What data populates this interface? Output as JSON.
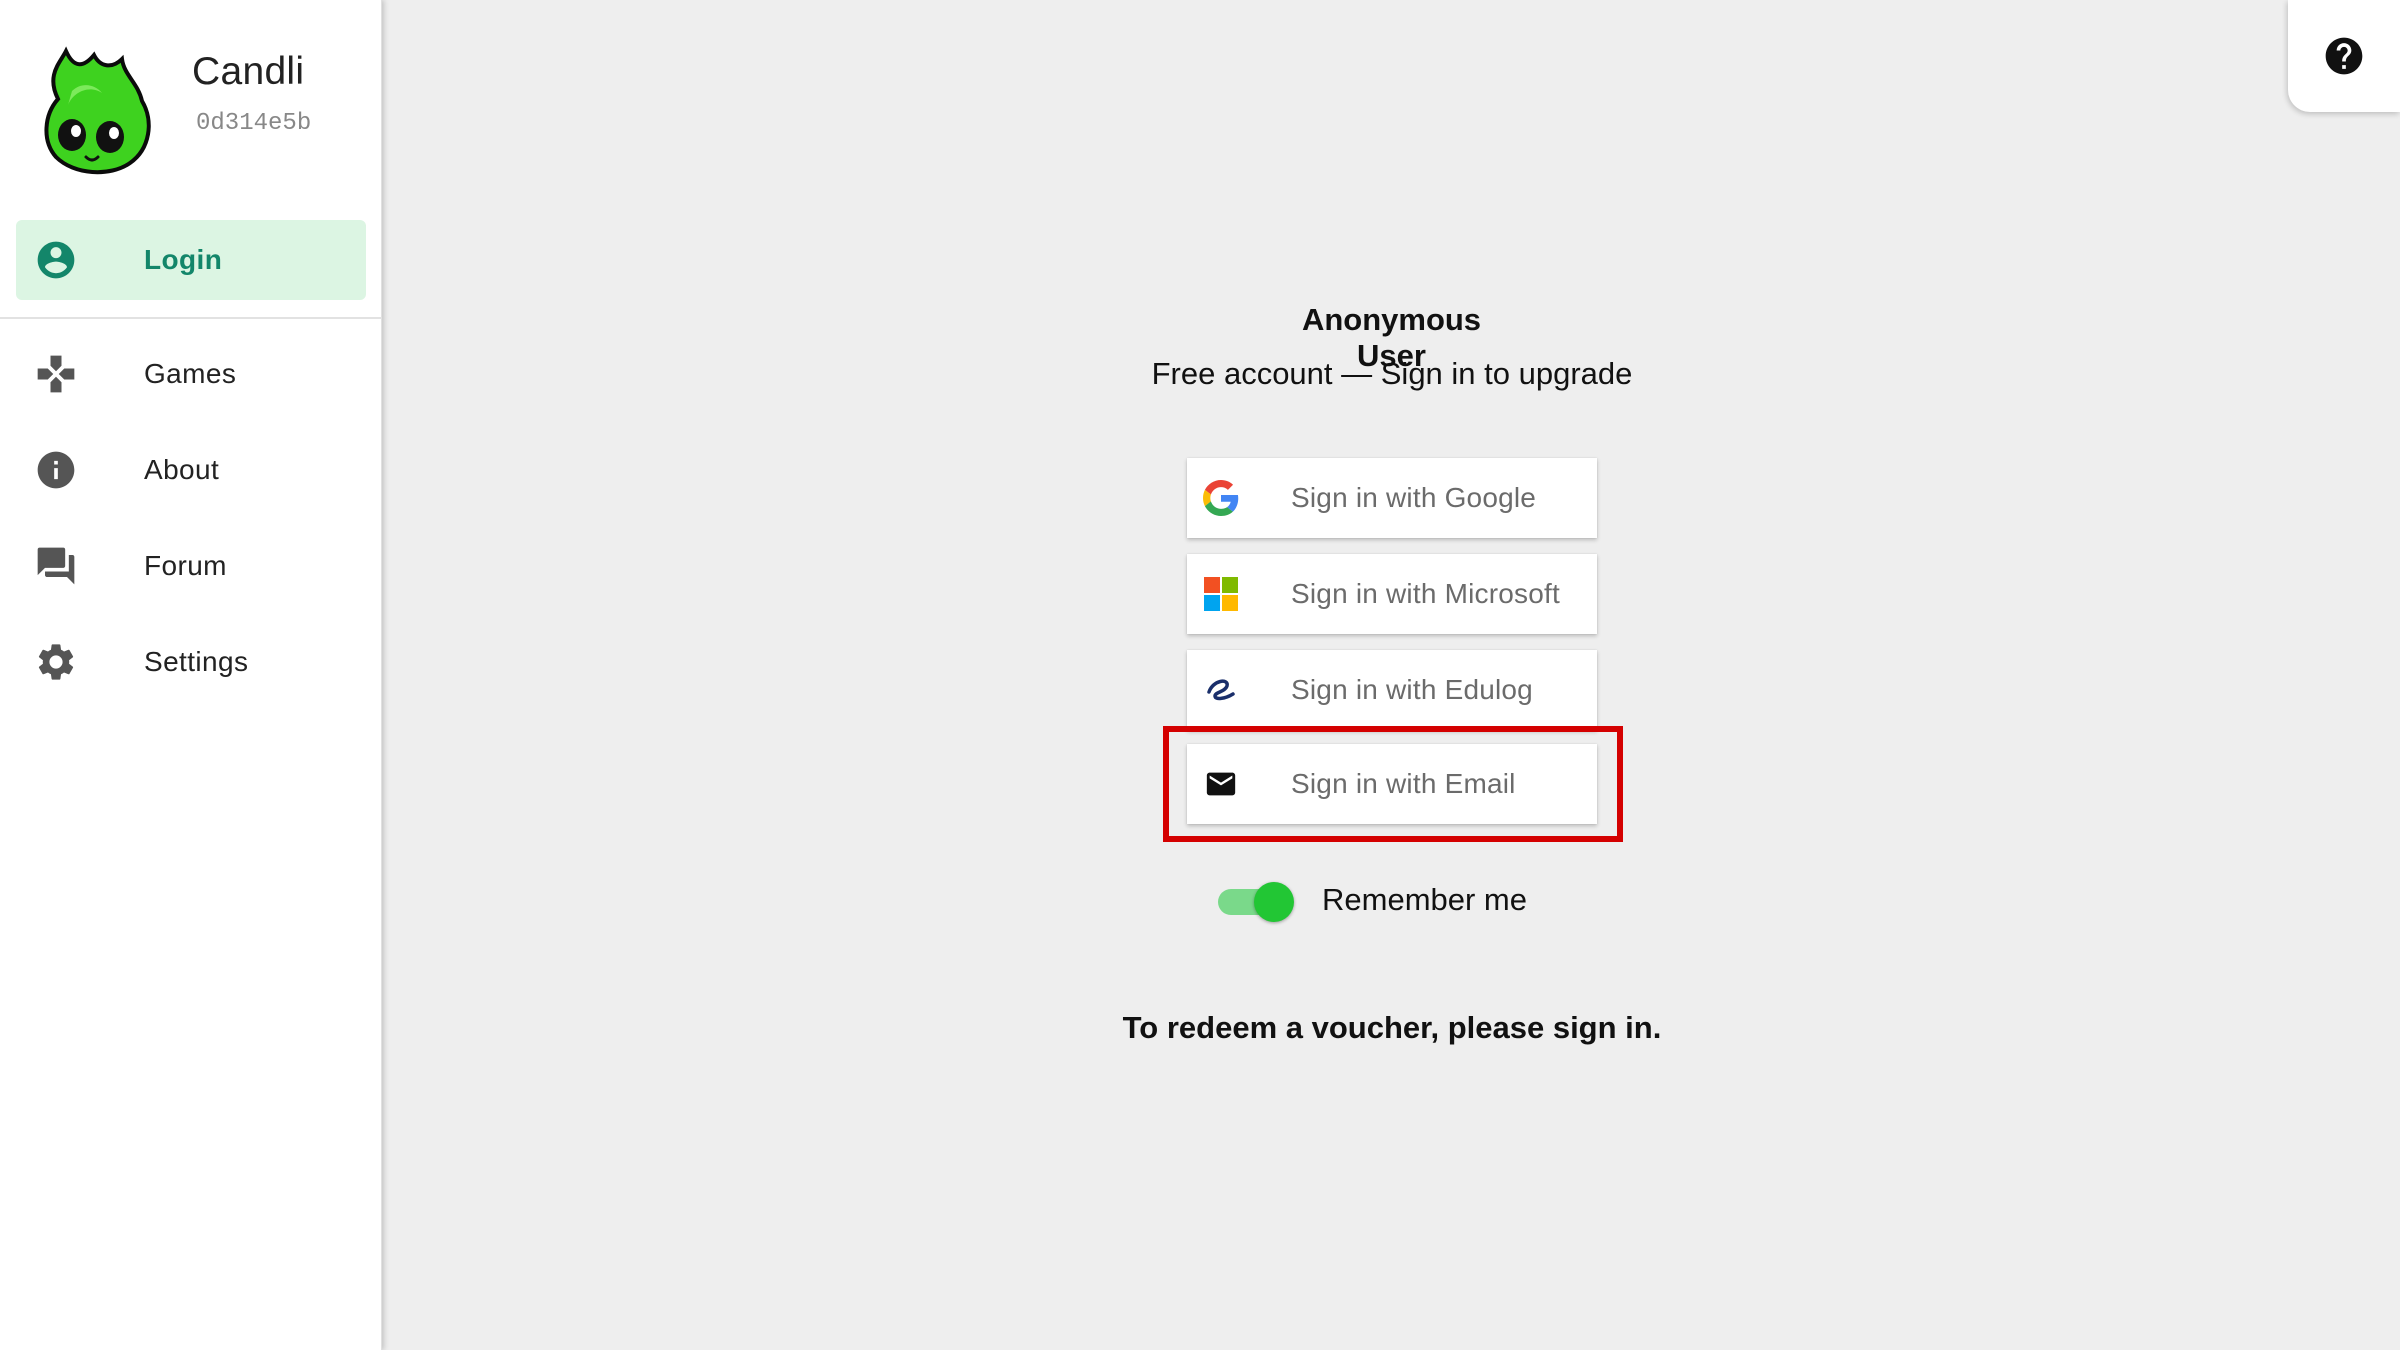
{
  "brand": {
    "name": "Candli",
    "id": "0d314e5b"
  },
  "sidebar": {
    "items": [
      {
        "label": "Login",
        "icon": "account-circle-icon",
        "active": true
      },
      {
        "label": "Games",
        "icon": "gamepad-icon",
        "active": false
      },
      {
        "label": "About",
        "icon": "info-icon",
        "active": false
      },
      {
        "label": "Forum",
        "icon": "forum-icon",
        "active": false
      },
      {
        "label": "Settings",
        "icon": "gear-icon",
        "active": false
      }
    ]
  },
  "help": {
    "icon": "help-circle-icon"
  },
  "account": {
    "name": "Anonymous User",
    "status": "Free account — Sign in to upgrade"
  },
  "signin": {
    "google": "Sign in with Google",
    "microsoft": "Sign in with Microsoft",
    "edulog": "Sign in with Edulog",
    "email": "Sign in with Email"
  },
  "remember": {
    "label": "Remember me",
    "checked": true
  },
  "voucher_note": "To redeem a voucher, please sign in.",
  "colors": {
    "accent": "#13866a",
    "active_bg": "#dcf5e3",
    "toggle_on": "#22c634",
    "highlight": "#d40000"
  }
}
